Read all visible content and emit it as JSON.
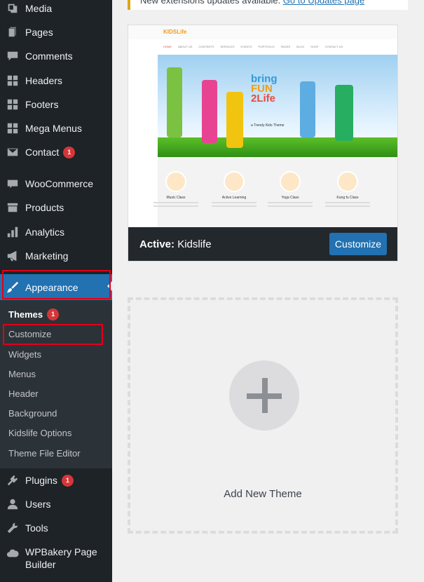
{
  "sidebar": {
    "items": [
      {
        "label": "Media",
        "icon": "media-icon"
      },
      {
        "label": "Pages",
        "icon": "pages-icon"
      },
      {
        "label": "Comments",
        "icon": "comments-icon"
      },
      {
        "label": "Headers",
        "icon": "grid-icon"
      },
      {
        "label": "Footers",
        "icon": "grid-icon"
      },
      {
        "label": "Mega Menus",
        "icon": "grid-icon"
      },
      {
        "label": "Contact",
        "icon": "mail-icon",
        "badge": "1"
      },
      {
        "label": "WooCommerce",
        "icon": "woo-icon"
      },
      {
        "label": "Products",
        "icon": "archive-icon"
      },
      {
        "label": "Analytics",
        "icon": "bar-chart-icon"
      },
      {
        "label": "Marketing",
        "icon": "megaphone-icon"
      },
      {
        "label": "Appearance",
        "icon": "paintbrush-icon"
      },
      {
        "label": "Plugins",
        "icon": "plug-icon",
        "badge": "1"
      },
      {
        "label": "Users",
        "icon": "user-icon"
      },
      {
        "label": "Tools",
        "icon": "wrench-icon"
      },
      {
        "label": "WPBakery Page Builder",
        "icon": "cloud-icon"
      }
    ],
    "submenu": [
      {
        "label": "Themes",
        "badge": "1"
      },
      {
        "label": "Customize"
      },
      {
        "label": "Widgets"
      },
      {
        "label": "Menus"
      },
      {
        "label": "Header"
      },
      {
        "label": "Background"
      },
      {
        "label": "Kidslife Options"
      },
      {
        "label": "Theme File Editor"
      }
    ]
  },
  "notice": {
    "text": "New extensions updates available.",
    "link": "Go to Updates page"
  },
  "theme_card": {
    "active_prefix": "Active:",
    "active_name": "Kidslife",
    "customize_label": "Customize",
    "preview": {
      "logo": "KIDSLife",
      "nav": [
        "HOME",
        "ABOUT US",
        "CONTENTS",
        "SERVICES",
        "EVENTS",
        "PORTFOLIO",
        "PAGES",
        "BLOG",
        "SHOP",
        "CONTACT US"
      ],
      "hero_line1": "bring",
      "hero_line2": "FUN",
      "hero_line3": "2Life",
      "hero_sub": "a Trendy Kids Theme",
      "features": [
        "Music Class",
        "Active Learning",
        "Yoga Class",
        "Kung fu Class"
      ]
    }
  },
  "add_new": {
    "label": "Add New Theme"
  },
  "colors": {
    "accent": "#2271b1",
    "sidebar_bg": "#1d2327",
    "badge": "#d63638",
    "highlight": "#e2001a"
  }
}
